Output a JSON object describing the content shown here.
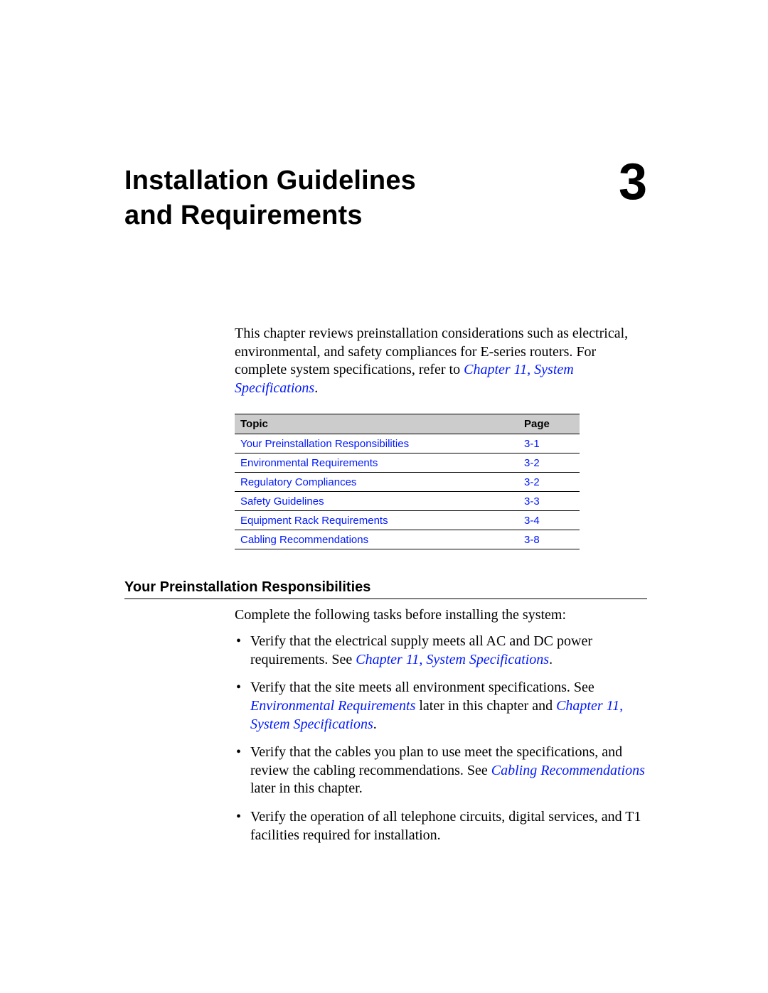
{
  "chapter": {
    "number": "3",
    "title_line1": "Installation Guidelines",
    "title_line2": "and Requirements"
  },
  "intro": {
    "text_before_link": "This chapter reviews preinstallation considerations such as electrical, environmental, and safety compliances for E-series routers. For complete system specifications, refer to ",
    "link_text": "Chapter 11, System Specifications",
    "text_after_link": "."
  },
  "toc": {
    "header_topic": "Topic",
    "header_page": "Page",
    "rows": [
      {
        "topic": "Your Preinstallation Responsibilities",
        "page": "3-1"
      },
      {
        "topic": "Environmental Requirements",
        "page": "3-2"
      },
      {
        "topic": "Regulatory Compliances",
        "page": "3-2"
      },
      {
        "topic": "Safety Guidelines",
        "page": "3-3"
      },
      {
        "topic": "Equipment Rack Requirements",
        "page": "3-4"
      },
      {
        "topic": "Cabling Recommendations",
        "page": "3-8"
      }
    ]
  },
  "section": {
    "heading": "Your Preinstallation Responsibilities",
    "intro": "Complete the following tasks before installing the system:",
    "bullets": [
      {
        "parts": [
          {
            "t": "text",
            "v": "Verify that the electrical supply meets all AC and DC power requirements. See "
          },
          {
            "t": "link",
            "v": "Chapter 11, System Specifications"
          },
          {
            "t": "text",
            "v": "."
          }
        ]
      },
      {
        "parts": [
          {
            "t": "text",
            "v": "Verify that the site meets all environment specifications. See "
          },
          {
            "t": "link",
            "v": "Environmental Requirements"
          },
          {
            "t": "text",
            "v": " later in this chapter and "
          },
          {
            "t": "link",
            "v": "Chapter 11, System Specifications"
          },
          {
            "t": "text",
            "v": "."
          }
        ]
      },
      {
        "parts": [
          {
            "t": "text",
            "v": "Verify that the cables you plan to use meet the specifications, and review the cabling recommendations. See "
          },
          {
            "t": "link",
            "v": "Cabling Recommendations"
          },
          {
            "t": "text",
            "v": " later in this chapter."
          }
        ]
      },
      {
        "parts": [
          {
            "t": "text",
            "v": "Verify the operation of all telephone circuits, digital services, and T1 facilities required for installation."
          }
        ]
      }
    ]
  }
}
